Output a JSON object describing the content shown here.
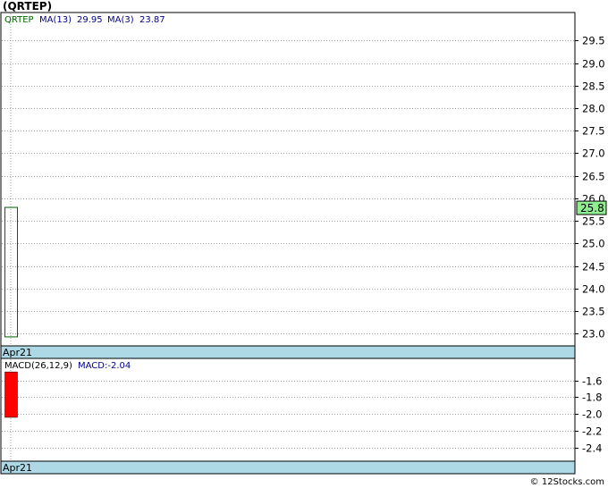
{
  "title": "(QRTEP)",
  "footer": "© 12Stocks.com",
  "colors": {
    "grid": "#a0a0a0",
    "frame": "#000000",
    "date_band": "#add8e6",
    "candle_up": "#006400",
    "price_badge": "#90ee90",
    "macd_bar": "#ff0000",
    "legend_ticker": "#006400",
    "legend_ma": "#00008b"
  },
  "legend": {
    "ticker": "QRTEP",
    "ma13_label": "MA(13)",
    "ma13_value": "29.95",
    "ma3_label": "MA(3)",
    "ma3_value": "23.87"
  },
  "macd_legend": {
    "label": "MACD(26,12,9)",
    "value_label": "MACD:-2.04"
  },
  "price_badge": "25.8",
  "date_label": "Apr21",
  "chart_data": [
    {
      "type": "candlestick",
      "title": "(QRTEP)",
      "x": [
        "Apr21"
      ],
      "ylim": [
        22.75,
        30.1
      ],
      "yticks": [
        23.0,
        23.5,
        24.0,
        24.5,
        25.0,
        25.5,
        26.0,
        26.5,
        27.0,
        27.5,
        28.0,
        28.5,
        29.0,
        29.5
      ],
      "ytick_labels": [
        "23.0",
        "23.5",
        "24.0",
        "24.5",
        "25.0",
        "25.5",
        "26.0",
        "26.5",
        "27.0",
        "27.5",
        "28.0",
        "28.5",
        "29.0",
        "29.5"
      ],
      "candles": [
        {
          "date": "Apr21",
          "open": 22.93,
          "high": 25.8,
          "low": 22.93,
          "close": 25.8
        }
      ],
      "last_price": 25.8,
      "grid": true
    },
    {
      "type": "bar",
      "title": "MACD(26,12,9)",
      "x": [
        "Apr21"
      ],
      "ylim": [
        -2.55,
        -1.35
      ],
      "yticks": [
        -1.6,
        -1.8,
        -2.0,
        -2.2,
        -2.4
      ],
      "ytick_labels": [
        "-1.6",
        "-1.8",
        "-2.0",
        "-2.2",
        "-2.4"
      ],
      "bars": [
        {
          "date": "Apr21",
          "top": -1.5,
          "bottom": -2.04
        }
      ],
      "grid": true
    }
  ]
}
